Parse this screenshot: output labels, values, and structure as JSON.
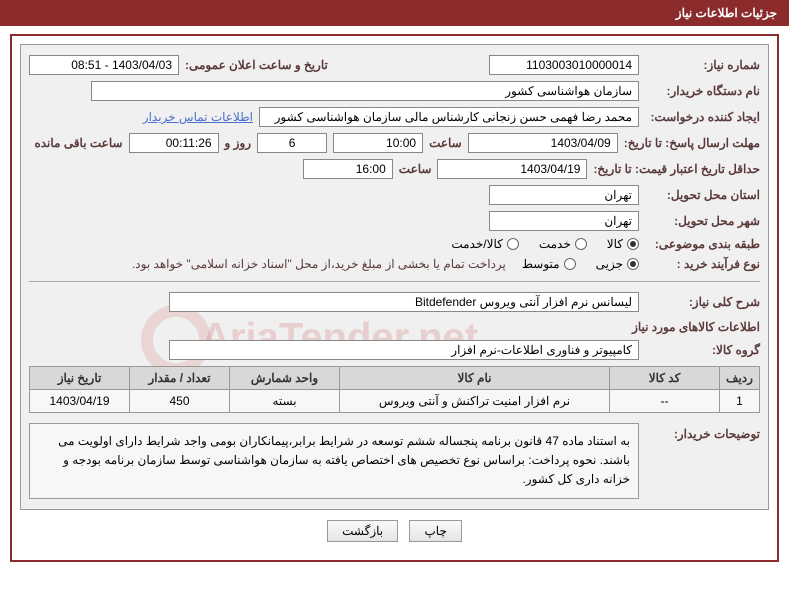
{
  "header": {
    "title": "جزئیات اطلاعات نیاز"
  },
  "fields": {
    "need_no_label": "شماره نیاز:",
    "need_no": "1103003010000014",
    "announce_label": "تاریخ و ساعت اعلان عمومی:",
    "announce_val": "1403/04/03 - 08:51",
    "buyer_org_label": "نام دستگاه خریدار:",
    "buyer_org": "سازمان هواشناسی کشور",
    "requester_label": "ایجاد کننده درخواست:",
    "requester": "محمد رضا فهمی حسن زنجانی کارشناس مالی سازمان هواشناسی کشور",
    "contact_link": "اطلاعات تماس خریدار",
    "resp_deadline_label": "مهلت ارسال پاسخ: تا تاریخ:",
    "resp_date": "1403/04/09",
    "time_label": "ساعت",
    "resp_time": "10:00",
    "days": "6",
    "days_and": "روز و",
    "countdown": "00:11:26",
    "remain": "ساعت باقی مانده",
    "price_valid_label": "حداقل تاریخ اعتبار قیمت: تا تاریخ:",
    "price_valid_date": "1403/04/19",
    "price_valid_time": "16:00",
    "province_label": "استان محل تحویل:",
    "province": "تهران",
    "city_label": "شهر محل تحویل:",
    "city": "تهران",
    "subject_class_label": "طبقه بندی موضوعی:",
    "radios1": {
      "kala": "کالا",
      "khadamat": "خدمت",
      "kala_khadamat": "کالا/خدمت"
    },
    "purchase_type_label": "نوع فرآیند خرید :",
    "radios2": {
      "jozi": "جزیی",
      "motavaset": "متوسط"
    },
    "purchase_note": "پرداخت تمام یا بخشی از مبلغ خرید،از محل \"اسناد خزانه اسلامی\" خواهد بود.",
    "desc_label": "شرح کلی نیاز:",
    "desc_val": "لیسانس نرم افزار آنتی ویروس Bitdefender",
    "goods_title": "اطلاعات کالاهای مورد نیاز",
    "goods_group_label": "گروه کالا:",
    "goods_group": "کامپیوتر و فناوری اطلاعات-نرم افزار",
    "buyer_notes_label": "توضیحات خریدار:",
    "buyer_notes": "به استناد ماده 47 قانون برنامه پنجساله ششم توسعه در شرایط برابر،پیمانکاران بومی واجد شرایط دارای اولویت می باشند. نحوه پرداخت: براساس نوع تخصیص های اختصاص یافته به سازمان هواشناسی توسط سازمان برنامه بودجه و خزانه داری کل کشور."
  },
  "table": {
    "headers": {
      "row": "ردیف",
      "code": "کد کالا",
      "name": "نام کالا",
      "unit": "واحد شمارش",
      "qty": "تعداد / مقدار",
      "date": "تاریخ نیاز"
    },
    "rows": [
      {
        "row": "1",
        "code": "--",
        "name": "نرم افزار امنیت تراکنش و آنتی ویروس",
        "unit": "بسته",
        "qty": "450",
        "date": "1403/04/19"
      }
    ]
  },
  "buttons": {
    "print": "چاپ",
    "back": "بازگشت"
  },
  "watermark": "AriaTender.net"
}
